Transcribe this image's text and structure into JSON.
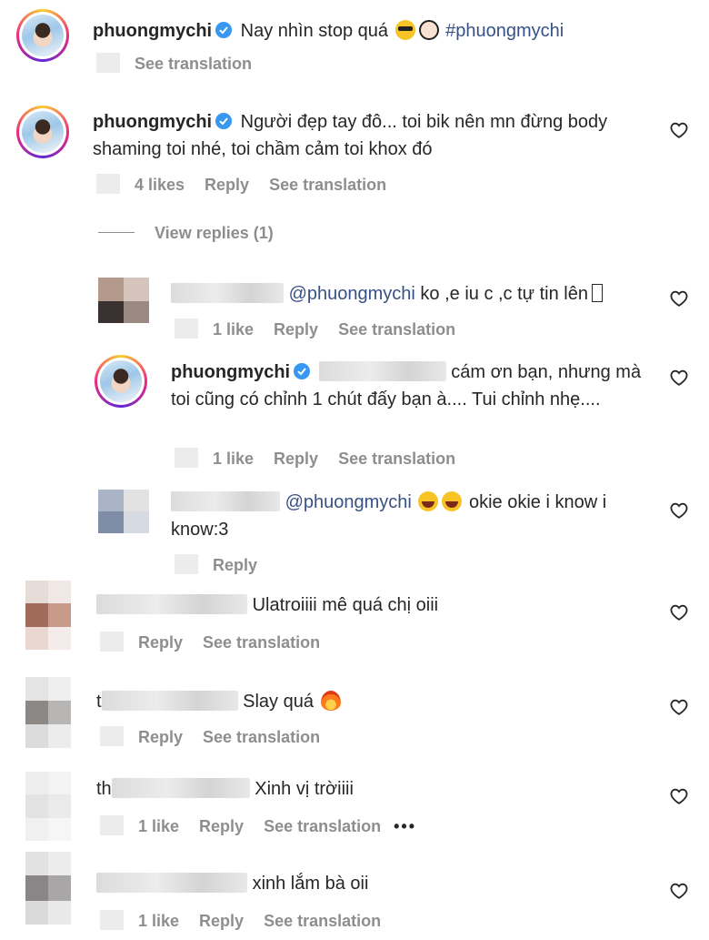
{
  "comments": [
    {
      "username": "phuongmychi",
      "text": "Nay nhìn stop quá",
      "hashtag": "#phuongmychi",
      "actions": {
        "see_translation": "See translation"
      }
    },
    {
      "username": "phuongmychi",
      "text": "Người đẹp tay đô... toi bik nên mn đừng body shaming toi nhé, toi chầm cảm toi khox đó",
      "actions": {
        "likes": "4 likes",
        "reply": "Reply",
        "see_translation": "See translation"
      },
      "view_replies": "View replies (1)"
    }
  ],
  "replies": [
    {
      "mention": "@phuongmychi",
      "text": "ko ,e iu c ,c tự tin lên",
      "actions": {
        "likes": "1 like",
        "reply": "Reply",
        "see_translation": "See translation"
      }
    },
    {
      "username": "phuongmychi",
      "text": "cám ơn bạn, nhưng mà toi cũng có chỉnh 1 chút đấy bạn à.... Tui chỉnh nhẹ....",
      "actions": {
        "likes": "1 like",
        "reply": "Reply",
        "see_translation": "See translation"
      }
    },
    {
      "mention": "@phuongmychi",
      "text": "okie okie i know i know:3",
      "actions": {
        "reply": "Reply"
      }
    }
  ],
  "others": [
    {
      "text": "Ulatroiiii mê quá chị oiii",
      "actions": {
        "reply": "Reply",
        "see_translation": "See translation"
      }
    },
    {
      "prefix": "t",
      "text": "Slay quá",
      "actions": {
        "reply": "Reply",
        "see_translation": "See translation"
      }
    },
    {
      "prefix": "th",
      "text": "Xinh vị trờiiii",
      "actions": {
        "likes": "1 like",
        "reply": "Reply",
        "see_translation": "See translation",
        "more": "•••"
      }
    },
    {
      "text": "xinh lắm bà oii",
      "actions": {
        "likes": "1 like",
        "reply": "Reply",
        "see_translation": "See translation"
      }
    }
  ],
  "icons": {
    "like": "heart-outline-icon",
    "verified": "verified-badge-icon"
  },
  "colors": {
    "text": "#262626",
    "secondary": "#8e8e8e",
    "link": "#385185",
    "verified": "#3897f0"
  }
}
